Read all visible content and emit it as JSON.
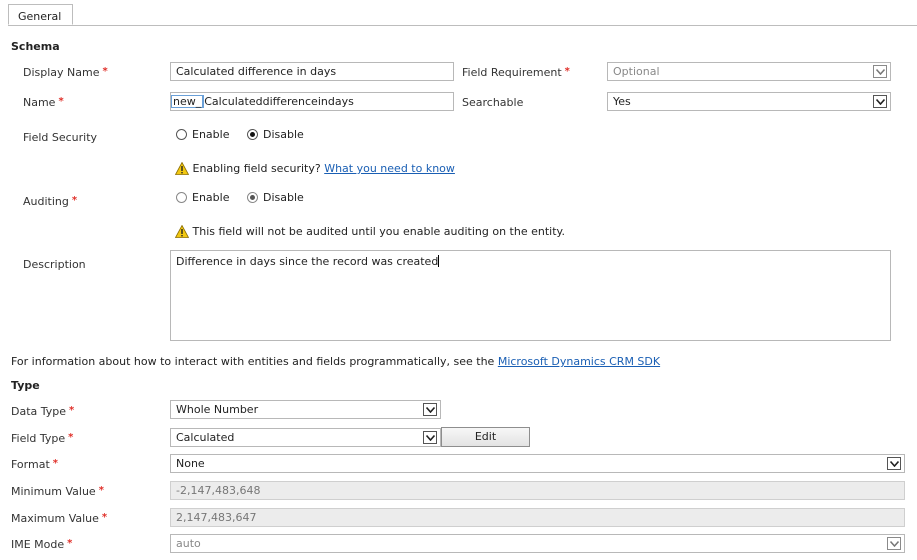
{
  "tabs": [
    {
      "label": "General",
      "active": true
    }
  ],
  "schema": {
    "heading": "Schema",
    "display_name": {
      "label": "Display Name",
      "value": "Calculated difference in days"
    },
    "field_requirement": {
      "label": "Field Requirement",
      "value": "Optional"
    },
    "name": {
      "label": "Name",
      "prefix": "new_",
      "value": "Calculateddifferenceindays"
    },
    "searchable": {
      "label": "Searchable",
      "value": "Yes"
    },
    "field_security": {
      "label": "Field Security",
      "options": [
        "Enable",
        "Disable"
      ],
      "selected": "Disable",
      "warning_text": "Enabling field security?",
      "warning_link": "What you need to know"
    },
    "auditing": {
      "label": "Auditing",
      "options": [
        "Enable",
        "Disable"
      ],
      "selected": "Disable",
      "warning_text": "This field will not be audited until you enable auditing on the entity."
    },
    "description": {
      "label": "Description",
      "value": "Difference in days since the record was created"
    }
  },
  "sdk_note": {
    "text": "For information about how to interact with entities and fields programmatically, see the",
    "link": "Microsoft Dynamics CRM SDK"
  },
  "type": {
    "heading": "Type",
    "data_type": {
      "label": "Data Type",
      "value": "Whole Number"
    },
    "field_type": {
      "label": "Field Type",
      "value": "Calculated",
      "edit_label": "Edit"
    },
    "format": {
      "label": "Format",
      "value": "None"
    },
    "minimum_value": {
      "label": "Minimum Value",
      "value": "-2,147,483,648"
    },
    "maximum_value": {
      "label": "Maximum Value",
      "value": "2,147,483,647"
    },
    "ime_mode": {
      "label": "IME Mode",
      "value": "auto"
    }
  },
  "required_marker": "*",
  "colors": {
    "required": "#e0302a",
    "link": "#1a5fb4",
    "warning": "#f2c811"
  }
}
